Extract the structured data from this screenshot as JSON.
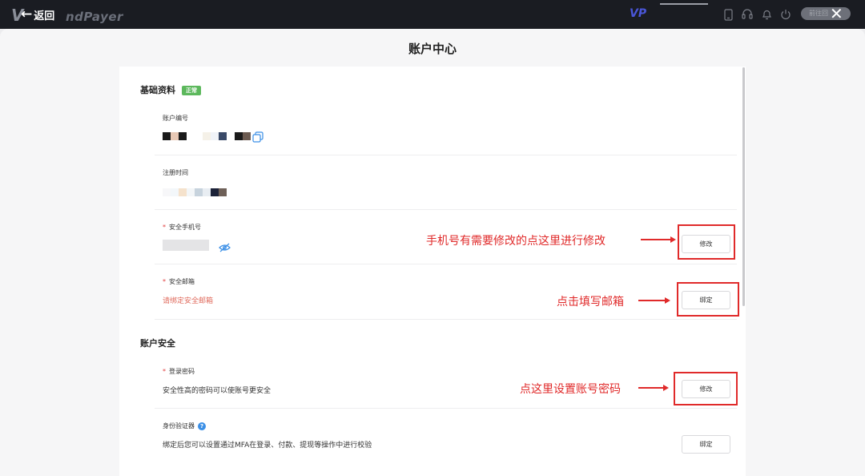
{
  "topbar": {
    "back_label": "返回",
    "brand_mark": "V",
    "brand_text": "ndPayer",
    "vip_text": "VP",
    "pill_text": "前往回",
    "close_glyph": "✕",
    "icons": [
      "phone-icon",
      "headset-icon",
      "bell-icon",
      "power-icon"
    ]
  },
  "page": {
    "title": "账户中心"
  },
  "basic": {
    "title": "基础资料",
    "status_badge": "正常",
    "account_no": {
      "label": "账户编号"
    },
    "register_time": {
      "label": "注册时间"
    },
    "phone": {
      "label": "安全手机号",
      "required": "*",
      "button": "修改"
    },
    "email": {
      "label": "安全邮箱",
      "required": "*",
      "value": "请绑定安全邮箱",
      "button": "绑定"
    }
  },
  "security": {
    "title": "账户安全",
    "password": {
      "label": "登录密码",
      "required": "*",
      "desc": "安全性高的密码可以使账号更安全",
      "button": "修改"
    },
    "authenticator": {
      "label": "身份验证器",
      "help": "?",
      "desc": "绑定后您可以设置通过MFA在登录、付款、提现等操作中进行校验",
      "button": "绑定"
    }
  },
  "annotations": {
    "phone": "手机号有需要修改的点这里进行修改",
    "email": "点击填写邮箱",
    "password": "点这里设置账号密码"
  },
  "colors": {
    "accent_red": "#e02a2a",
    "badge_green": "#5cb85c",
    "topbar": "#1a1c22"
  }
}
